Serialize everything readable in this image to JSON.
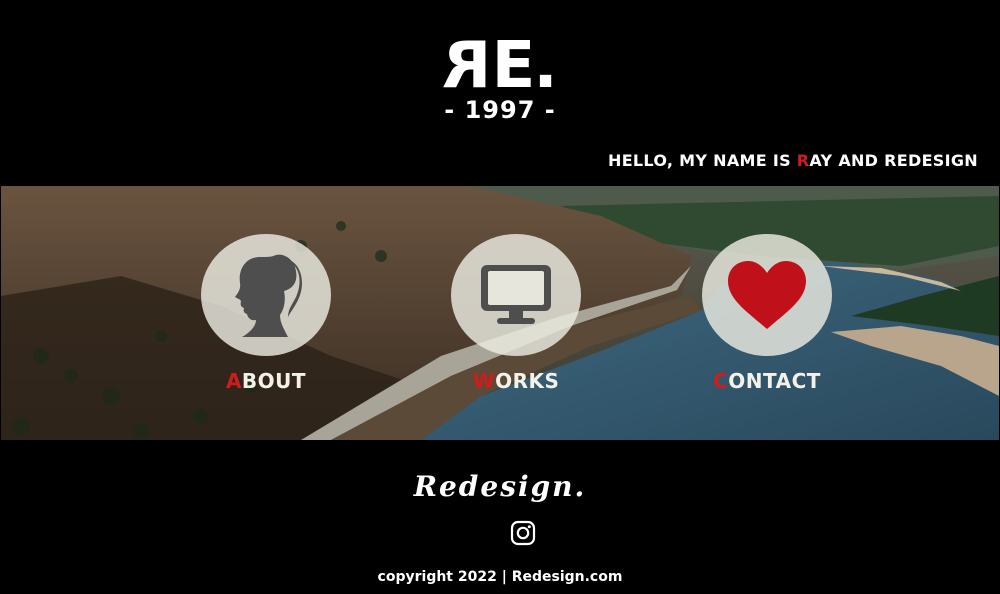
{
  "header": {
    "logo_letter_r": "R",
    "logo_rest": "E.",
    "year": "- 1997 -",
    "hello_before": "HELLO, MY NAME IS ",
    "hello_highlight": "R",
    "hello_after": "AY AND REDESIGN"
  },
  "nav": {
    "about": {
      "first": "A",
      "rest": "BOUT",
      "icon": "woman-silhouette-icon"
    },
    "works": {
      "first": "W",
      "rest": "ORKS",
      "icon": "monitor-icon"
    },
    "contact": {
      "first": "C",
      "rest": "ONTACT",
      "icon": "heart-icon"
    }
  },
  "footer": {
    "brand": "Redesign.",
    "social_icon": "instagram-icon",
    "copyright": "copyright 2022 | Redesign.com"
  },
  "colors": {
    "accent": "#d01c1c",
    "background": "#000000",
    "text": "#ffffff"
  }
}
